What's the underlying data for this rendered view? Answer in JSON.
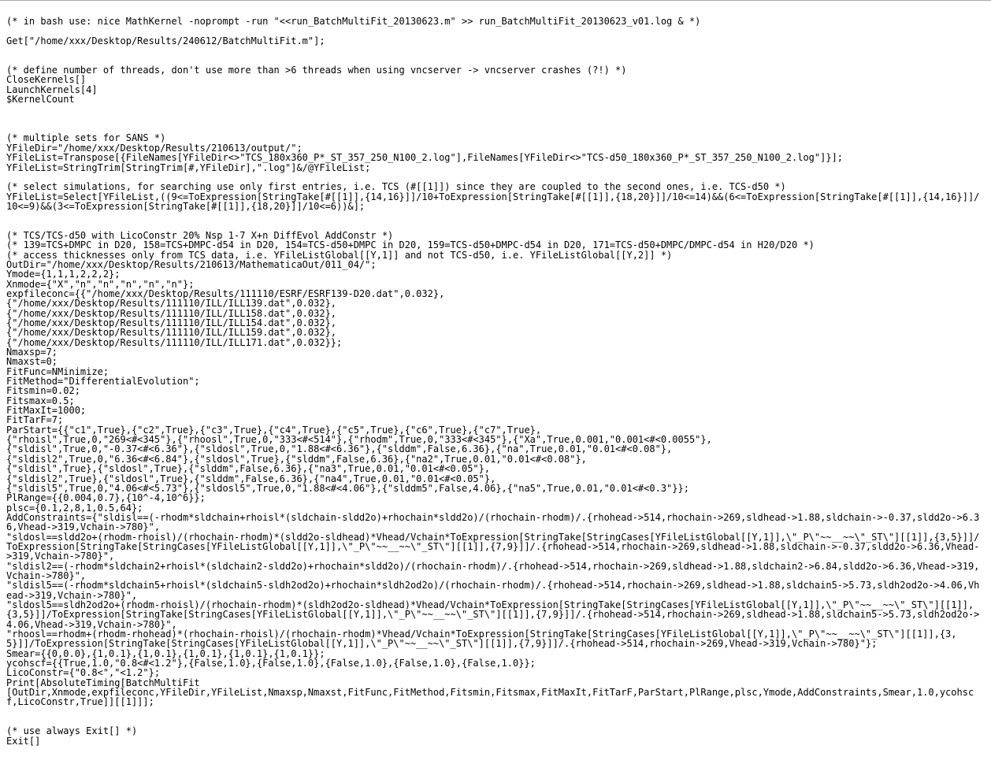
{
  "code": "(* in bash use: nice MathKernel -noprompt -run \"<<run_BatchMultiFit_20130623.m\" >> run_BatchMultiFit_20130623_v01.log & *)\n\nGet[\"/home/xxx/Desktop/Results/240612/BatchMultiFit.m\"];\n\n\n(* define number of threads, don't use more than >6 threads when using vncserver -> vncserver crashes (?!) *)\nCloseKernels[]\nLaunchKernels[4]\n$KernelCount\n\n\n\n(* multiple sets for SANS *)\nYFileDir=\"/home/xxx/Desktop/Results/210613/output/\";\nYFileList=Transpose[{FileNames[YFileDir<>\"TCS_180x360_P*_ST_357_250_N100_2.log\"],FileNames[YFileDir<>\"TCS-d50_180x360_P*_ST_357_250_N100_2.log\"]}];\nYFileList=StringTrim[StringTrim[#,YFileDir],\".log\"]&/@YFileList;\n\n(* select simulations, for searching use only first entries, i.e. TCS (#[[1]]) since they are coupled to the second ones, i.e. TCS-d50 *)\nYFileList=Select[YFileList,((9<=ToExpression[StringTake[#[[1]],{14,16}]]/10+ToExpression[StringTake[#[[1]],{18,20}]]/10<=14)&&(6<=ToExpression[StringTake[#[[1]],{14,16}]]/10<=9)&&(3<=ToExpression[StringTake[#[[1]],{18,20}]]/10<=6))&];\n\n\n(* TCS/TCS-d50 with LicoConstr 20% Nsp 1-7 X+n DiffEvol AddConstr *)\n(* 139=TCS+DMPC in D20, 158=TCS+DMPC-d54 in D20, 154=TCS-d50+DMPC in D20, 159=TCS-d50+DMPC-d54 in D20, 171=TCS-d50+DMPC/DMPC-d54 in H20/D20 *)\n(* access thicknesses only from TCS data, i.e. YFileListGlobal[[Y,1]] and not TCS-d50, i.e. YFileListGlobal[[Y,2]] *)\nOutDir=\"/home/xxx/Desktop/Results/210613/MathematicaOut/011_04/\";\nYmode={1,1,1,2,2,2};\nXnmode={\"X\",\"n\",\"n\",\"n\",\"n\",\"n\"};\nexpfileconc={{\"/home/xxx/Desktop/Results/111110/ESRF/ESRF139-D20.dat\",0.032},\n{\"/home/xxx/Desktop/Results/111110/ILL/ILL139.dat\",0.032},\n{\"/home/xxx/Desktop/Results/111110/ILL/ILL158.dat\",0.032},\n{\"/home/xxx/Desktop/Results/111110/ILL/ILL154.dat\",0.032},\n{\"/home/xxx/Desktop/Results/111110/ILL/ILL159.dat\",0.032},\n{\"/home/xxx/Desktop/Results/111110/ILL/ILL171.dat\",0.032}};\nNmaxsp=7;\nNmaxst=0;\nFitFunc=NMinimize;\nFitMethod=\"DifferentialEvolution\";\nFitsmin=0.02;\nFitsmax=0.5;\nFitMaxIt=1000;\nFitTarF=7;\nParStart={{\"c1\",True},{\"c2\",True},{\"c3\",True},{\"c4\",True},{\"c5\",True},{\"c6\",True},{\"c7\",True},\n{\"rhoisl\",True,0,\"269<#<345\"},{\"rhoosl\",True,0,\"333<#<514\"},{\"rhodm\",True,0,\"333<#<345\"},{\"Xa\",True,0.001,\"0.001<#<0.0055\"},\n{\"sldisl\",True,0,\"-0.37<#<6.36\"},{\"sldosl\",True,0,\"1.88<#<6.36\"},{\"slddm\",False,6.36},{\"na\",True,0.01,\"0.01<#<0.08\"},\n{\"sldisl2\",True,0,\"6.36<#<6.84\"},{\"sldosl\",True},{\"slddm\",False,6.36},{\"na2\",True,0.01,\"0.01<#<0.08\"},\n{\"sldisl\",True},{\"sldosl\",True},{\"slddm\",False,6.36},{\"na3\",True,0.01,\"0.01<#<0.05\"},\n{\"sldisl2\",True},{\"sldosl\",True},{\"slddm\",False,6.36},{\"na4\",True,0.01,\"0.01<#<0.05\"},\n{\"sldisl5\",True,0,\"4.06<#<5.73\"},{\"sldosl5\",True,0,\"1.88<#<4.06\"},{\"slddm5\",False,4.06},{\"na5\",True,0.01,\"0.01<#<0.3\"}};\nPlRange={{0.004,0.7},{10^-4,10^6}};\nplsc={0.1,2,8,1,0.5,64};\nAddConstraints={\"sldisl==(-rhodm*sldchain+rhoisl*(sldchain-sldd2o)+rhochain*sldd2o)/(rhochain-rhodm)/.{rhohead->514,rhochain->269,sldhead->1.88,sldchain->-0.37,sldd2o->6.36,Vhead->319,Vchain->780}\",\n\"sldosl==sldd2o+(rhodm-rhoisl)/(rhochain-rhodm)*(sldd2o-sldhead)*Vhead/Vchain*ToExpression[StringTake[StringCases[YFileListGlobal[[Y,1]],\\\"_P\\\"~~__~~\\\"_ST\\\"][[1]],{3,5}]]/ToExpression[StringTake[StringCases[YFileListGlobal[[Y,1]],\\\"_P\\\"~~__~~\\\"_ST\\\"][[1]],{7,9}]]/.{rhohead->514,rhochain->269,sldhead->1.88,sldchain->-0.37,sldd2o->6.36,Vhead->319,Vchain->780}\",\n\"sldisl2==(-rhodm*sldchain2+rhoisl*(sldchain2-sldd2o)+rhochain*sldd2o)/(rhochain-rhodm)/.{rhohead->514,rhochain->269,sldhead->1.88,sldchain2->6.84,sldd2o->6.36,Vhead->319,Vchain->780}\",\n\"sldisl5==(-rhodm*sldchain5+rhoisl*(sldchain5-sldh2od2o)+rhochain*sldh2od2o)/(rhochain-rhodm)/.{rhohead->514,rhochain->269,sldhead->1.88,sldchain5->5.73,sldh2od2o->4.06,Vhead->319,Vchain->780}\",\n\"sldosl5==sldh2od2o+(rhodm-rhoisl)/(rhochain-rhodm)*(sldh2od2o-sldhead)*Vhead/Vchain*ToExpression[StringTake[StringCases[YFileListGlobal[[Y,1]],\\\"_P\\\"~~__~~\\\"_ST\\\"][[1]],{3,5}]]/ToExpression[StringTake[StringCases[YFileListGlobal[[Y,1]],\\\"_P\\\"~~__~~\\\"_ST\\\"][[1]],{7,9}]]/.{rhohead->514,rhochain->269,sldhead->1.88,sldchain5->5.73,sldh2od2o->4.06,Vhead->319,Vchain->780}\",\n\"rhoosl==rhodm+(rhodm-rhohead)*(rhochain-rhoisl)/(rhochain-rhodm)*Vhead/Vchain*ToExpression[StringTake[StringCases[YFileListGlobal[[Y,1]],\\\"_P\\\"~~__~~\\\"_ST\\\"][[1]],{3,5}]]/ToExpression[StringTake[StringCases[YFileListGlobal[[Y,1]],\\\"_P\\\"~~__~~\\\"_ST\\\"][[1]],{7,9}]]/.{rhohead->514,rhochain->269,Vhead->319,Vchain->780}\"};\nSmear={{0,0.0},{1,0.1},{1,0.1},{1,0.1},{1,0.1},{1,0.1}};\nycohscf={{True,1.0,\"0.8<#<1.2\"},{False,1.0},{False,1.0},{False,1.0},{False,1.0},{False,1.0}};\nLicoConstr={\"0.8<\",\"<1.2\"};\nPrint[AbsoluteTiming[BatchMultiFit\n[OutDir,Xnmode,expfileconc,YFileDir,YFileList,Nmaxsp,Nmaxst,FitFunc,FitMethod,Fitsmin,Fitsmax,FitMaxIt,FitTarF,ParStart,PlRange,plsc,Ymode,AddConstraints,Smear,1.0,ycohscf,LicoConstr,True]][[1]]];\n\n\n(* use always Exit[] *)\nExit[]"
}
